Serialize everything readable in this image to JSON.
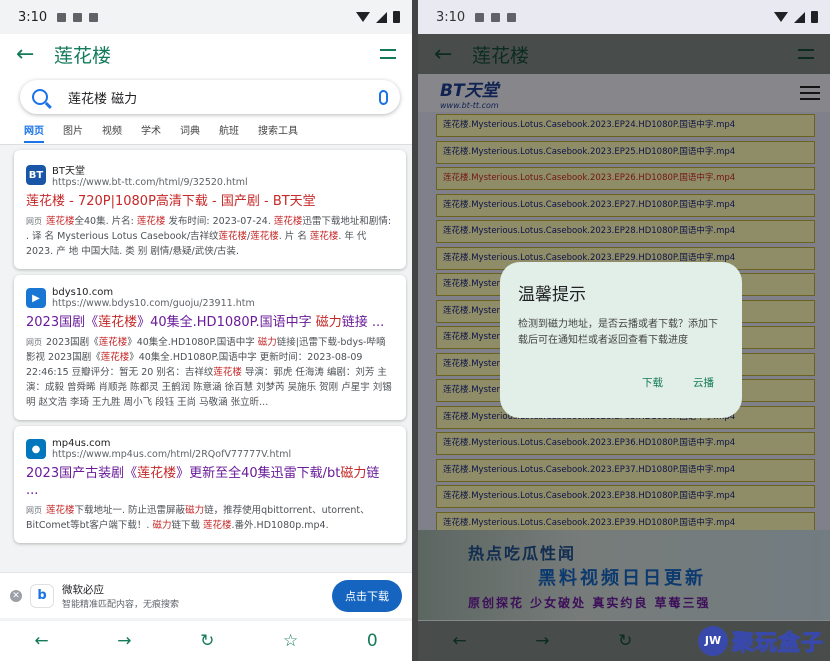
{
  "left": {
    "status": {
      "time": "3:10"
    },
    "appbar": {
      "title": "莲花楼",
      "back_icon": "←"
    },
    "search": {
      "query": "莲花楼 磁力"
    },
    "tabs": [
      "网页",
      "图片",
      "视频",
      "学术",
      "词典",
      "航班",
      "搜索工具"
    ],
    "results": [
      {
        "favicon": "BT",
        "favicon_color": "#1a56a8",
        "site": "BT天堂",
        "url": "https://www.bt-tt.com/html/9/32520.html",
        "title": "莲花楼 - 720P|1080P高清下载 - 国产剧 - BT天堂",
        "title_red": true,
        "tag": "网页",
        "snippet": "莲花楼全40集. 片名: 莲花楼 发布时间: 2023-07-24. 莲花楼迅雷下载地址和剧情: . 译 名 Mysterious Lotus Casebook/吉祥纹莲花楼/莲花楼. 片 名 莲花楼. 年 代 2023. 产 地 中国大陆. 类 别 剧情/悬疑/武侠/古装."
      },
      {
        "favicon": "▶",
        "favicon_color": "#1976d2",
        "site": "bdys10.com",
        "url": "https://www.bdys10.com/guoju/23911.htm",
        "title": "2023国剧《莲花楼》40集全.HD1080P.国语中字 磁力链接 ...",
        "title_red": false,
        "tag": "网页",
        "snippet": "2023国剧《莲花楼》40集全.HD1080P.国语中字 磁力链接|迅雷下载-bdys-哔嘀影视 2023国剧《莲花楼》40集全.HD1080P.国语中字 更新时间：2023-08-09 22:46:15 豆瓣评分：暂无 20 别名：吉祥纹莲花楼 导演：郭虎 任海涛 编剧：刘芳 主演：成毅 曾舜晞 肖顺尧 陈都灵 王鹤润 陈意涵 徐百慧 刘梦芮 吴施乐 贺刚 卢星宇 刘锡明 赵文浩 李琦 王九胜 周小飞 段钰 王尚 马敬涵 张立昕..."
      },
      {
        "favicon": "●",
        "favicon_color": "#0277bd",
        "site": "mp4us.com",
        "url": "https://www.mp4us.com/html/2RQofV77777V.html",
        "title": "2023国产古装剧《莲花楼》更新至全40集迅雷下载/bt磁力链 ...",
        "title_red": false,
        "tag": "网页",
        "snippet": "莲花楼下载地址一. 防止迅雷屏蔽磁力链，推荐使用qbittorrent、utorrent、BitComet等bt客户端下载！. 磁力链下载 莲花楼.番外.HD1080p.mp4."
      }
    ],
    "ad": {
      "logo": "b",
      "title": "微软必应",
      "subtitle": "智能精准匹配内容，无痕搜索",
      "button": "点击下载"
    },
    "nav": {
      "back": "←",
      "forward": "→",
      "refresh": "↻",
      "star": "☆",
      "count": "0"
    }
  },
  "right": {
    "status": {
      "time": "3:10"
    },
    "appbar": {
      "title": "莲花楼",
      "back_icon": "←"
    },
    "site_logo": {
      "big": "BT天堂",
      "small": "www.bt-tt.com"
    },
    "files": [
      {
        "name": "莲花楼.Mysterious.Lotus.Casebook.2023.EP24.HD1080P.国语中字.mp4",
        "red": false
      },
      {
        "name": "莲花楼.Mysterious.Lotus.Casebook.2023.EP25.HD1080P.国语中字.mp4",
        "red": false
      },
      {
        "name": "莲花楼.Mysterious.Lotus.Casebook.2023.EP26.HD1080P.国语中字.mp4",
        "red": true
      },
      {
        "name": "莲花楼.Mysterious.Lotus.Casebook.2023.EP27.HD1080P.国语中字.mp4",
        "red": false
      },
      {
        "name": "莲花楼.Mysterious.Lotus.Casebook.2023.EP28.HD1080P.国语中字.mp4",
        "red": false
      },
      {
        "name": "莲花楼.Mysterious.Lotus.Casebook.2023.EP29.HD1080P.国语中字.mp4",
        "red": false
      },
      {
        "name": "莲花楼.Mysterious.Lotus.Casebook.2023.EP30.HD1080P.国语中字.mp4",
        "red": false
      },
      {
        "name": "莲花楼.Mysterious.Lotus.Casebook.2023.EP31.HD1080P.国语中字.mp4",
        "red": false
      },
      {
        "name": "莲花楼.Mysterious.Lotus.Casebook.2023.EP32.HD1080P.国语中字.mp4",
        "red": false
      },
      {
        "name": "莲花楼.Mysterious.Lotus.Casebook.2023.EP33.HD1080P.国语中字.mp4",
        "red": false
      },
      {
        "name": "莲花楼.Mysterious.Lotus.Casebook.2023.EP34.HD1080P.国语中字.mp4",
        "red": false
      },
      {
        "name": "莲花楼.Mysterious.Lotus.Casebook.2023.EP35.HD1080P.国语中字.mp4",
        "red": false
      },
      {
        "name": "莲花楼.Mysterious.Lotus.Casebook.2023.EP36.HD1080P.国语中字.mp4",
        "red": false
      },
      {
        "name": "莲花楼.Mysterious.Lotus.Casebook.2023.EP37.HD1080P.国语中字.mp4",
        "red": false
      },
      {
        "name": "莲花楼.Mysterious.Lotus.Casebook.2023.EP38.HD1080P.国语中字.mp4",
        "red": false
      },
      {
        "name": "莲花楼.Mysterious.Lotus.Casebook.2023.EP39.HD1080P.国语中字.mp4",
        "red": false
      }
    ],
    "banner": {
      "line1": "热点吃瓜性闻",
      "line2": "黑料视频日日更新",
      "line3": "原创探花 少女破处 真实约良 草莓三强"
    },
    "dialog": {
      "title": "温馨提示",
      "message": "检测到磁力地址，是否云播或者下载？添加下载后可在通知栏或者返回查看下载进度",
      "download": "下载",
      "cloudplay": "云播"
    },
    "nav": {
      "back": "←",
      "forward": "→",
      "refresh": "↻",
      "star": "☆",
      "count": "0"
    },
    "watermark": {
      "badge": "JW",
      "text": "聚玩盒子"
    }
  }
}
